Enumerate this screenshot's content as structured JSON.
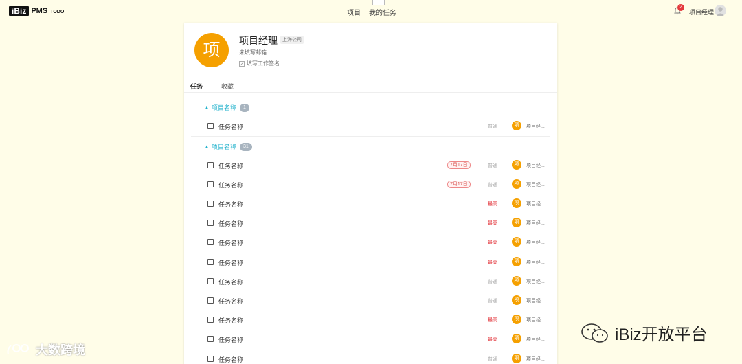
{
  "header": {
    "logo_box": "iBiz",
    "logo_pms": "PMS",
    "logo_todo": "TODO",
    "nav": [
      "项目",
      "我的任务"
    ],
    "notification_count": "2",
    "user_name": "项目经理"
  },
  "profile": {
    "avatar_char": "项",
    "name": "项目经理",
    "company": "上海公司",
    "email": "未填写邮箱",
    "signature": "填写工作签名"
  },
  "tabs": [
    "任务",
    "收藏"
  ],
  "groups": [
    {
      "title": "项目名称",
      "count": "1",
      "tasks": [
        {
          "name": "任务名称",
          "date": "",
          "priority": "普通",
          "priority_level": "normal",
          "assignee_char": "项",
          "assignee": "项目经..."
        }
      ]
    },
    {
      "title": "项目名称",
      "count": "31",
      "tasks": [
        {
          "name": "任务名称",
          "date": "7月17日",
          "priority": "普通",
          "priority_level": "normal",
          "assignee_char": "项",
          "assignee": "项目经..."
        },
        {
          "name": "任务名称",
          "date": "7月17日",
          "priority": "普通",
          "priority_level": "normal",
          "assignee_char": "项",
          "assignee": "项目经..."
        },
        {
          "name": "任务名称",
          "date": "",
          "priority": "最高",
          "priority_level": "high",
          "assignee_char": "项",
          "assignee": "项目经..."
        },
        {
          "name": "任务名称",
          "date": "",
          "priority": "最高",
          "priority_level": "high",
          "assignee_char": "项",
          "assignee": "项目经..."
        },
        {
          "name": "任务名称",
          "date": "",
          "priority": "最高",
          "priority_level": "high",
          "assignee_char": "项",
          "assignee": "项目经..."
        },
        {
          "name": "任务名称",
          "date": "",
          "priority": "最高",
          "priority_level": "high",
          "assignee_char": "项",
          "assignee": "项目经..."
        },
        {
          "name": "任务名称",
          "date": "",
          "priority": "普通",
          "priority_level": "normal",
          "assignee_char": "项",
          "assignee": "项目经..."
        },
        {
          "name": "任务名称",
          "date": "",
          "priority": "普通",
          "priority_level": "normal",
          "assignee_char": "项",
          "assignee": "项目经..."
        },
        {
          "name": "任务名称",
          "date": "",
          "priority": "最高",
          "priority_level": "high",
          "assignee_char": "项",
          "assignee": "项目经..."
        },
        {
          "name": "任务名称",
          "date": "",
          "priority": "最高",
          "priority_level": "high",
          "assignee_char": "项",
          "assignee": "项目经..."
        },
        {
          "name": "任务名称",
          "date": "",
          "priority": "普通",
          "priority_level": "normal",
          "assignee_char": "项",
          "assignee": "项目经..."
        }
      ]
    }
  ],
  "watermarks": {
    "left": "大数跨境",
    "right": "iBiz开放平台"
  }
}
